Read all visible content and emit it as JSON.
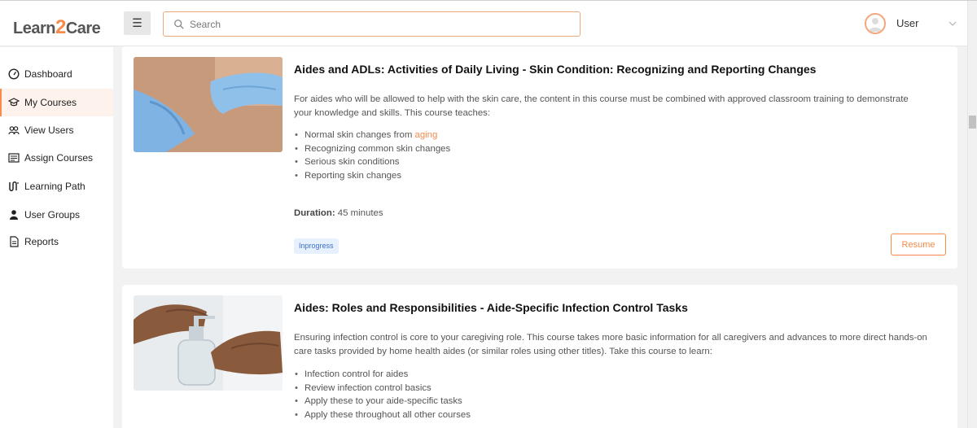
{
  "header": {
    "logo_part1": "Learn",
    "logo_part2": "2",
    "logo_part3": "Care",
    "search_placeholder": "Search",
    "user_name": "User"
  },
  "sidebar": {
    "items": [
      {
        "label": "Dashboard",
        "icon": "dashboard-icon"
      },
      {
        "label": "My Courses",
        "icon": "graduation-cap-icon",
        "active": true
      },
      {
        "label": "View Users",
        "icon": "users-icon"
      },
      {
        "label": "Assign Courses",
        "icon": "list-icon"
      },
      {
        "label": "Learning Path",
        "icon": "path-icon"
      },
      {
        "label": "User Groups",
        "icon": "user-icon"
      },
      {
        "label": "Reports",
        "icon": "report-icon"
      }
    ]
  },
  "courses": [
    {
      "title": "Aides and ADLs: Activities of Daily Living - Skin Condition: Recognizing and Reporting Changes",
      "description": "For aides who will be allowed to help with the skin care, the content in this course must be combined with approved classroom training to demonstrate your knowledge and skills. This course teaches:",
      "topics": [
        {
          "before": "Normal skin changes from ",
          "highlight": "aging"
        },
        {
          "before": "Recognizing common skin changes"
        },
        {
          "before": "Serious skin conditions"
        },
        {
          "before": "Reporting skin changes"
        }
      ],
      "duration_label": "Duration:",
      "duration_value": "45 minutes",
      "status": "Inprogress",
      "action": "Resume"
    },
    {
      "title": "Aides: Roles and Responsibilities - Aide-Specific Infection Control Tasks",
      "description": "Ensuring infection control is core to your caregiving role. This course takes more basic information for all caregivers and advances to more direct hands-on care tasks provided by home health aides (or similar roles using other titles). Take this course to learn:",
      "topics": [
        {
          "before": "Infection control for aides"
        },
        {
          "before": "Review infection control basics"
        },
        {
          "before": "Apply these to your aide-specific tasks"
        },
        {
          "before": "Apply these throughout all other courses"
        }
      ]
    }
  ],
  "colors": {
    "accent": "#f58b4c",
    "badge_bg": "#e7f0fd",
    "badge_text": "#3d6fd1"
  }
}
